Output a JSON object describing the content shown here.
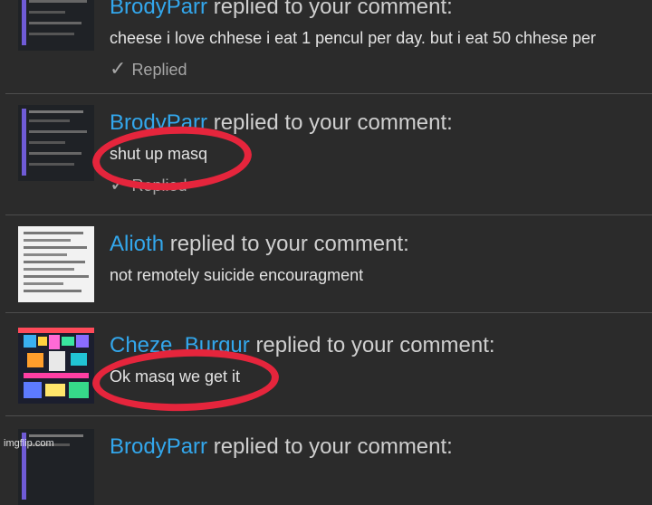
{
  "comments": [
    {
      "username": "BrodyParr",
      "action": "replied to your comment:",
      "message": "cheese i love chhese i eat 1 pencul per day. but i eat 50 chhese per",
      "status": "Replied",
      "avatar_icon": "comment-screenshot-thumbnail"
    },
    {
      "username": "BrodyParr",
      "action": "replied to your comment:",
      "message": "shut up masq",
      "status": "Replied",
      "avatar_icon": "comment-screenshot-thumbnail"
    },
    {
      "username": "Alioth",
      "action": "replied to your comment:",
      "message": "not remotely suicide encouragment",
      "avatar_icon": "text-screenshot-thumbnail"
    },
    {
      "username": "Cheze_Burgur",
      "action": "replied to your comment:",
      "message": "Ok masq we get it",
      "avatar_icon": "pixel-art-thumbnail"
    },
    {
      "username": "BrodyParr",
      "action": "replied to your comment:",
      "avatar_icon": "comment-screenshot-thumbnail"
    }
  ],
  "watermark": "imgflip.com",
  "colors": {
    "background": "#2b2b2b",
    "username": "#33a7ec",
    "highlight": "#e5253c"
  }
}
